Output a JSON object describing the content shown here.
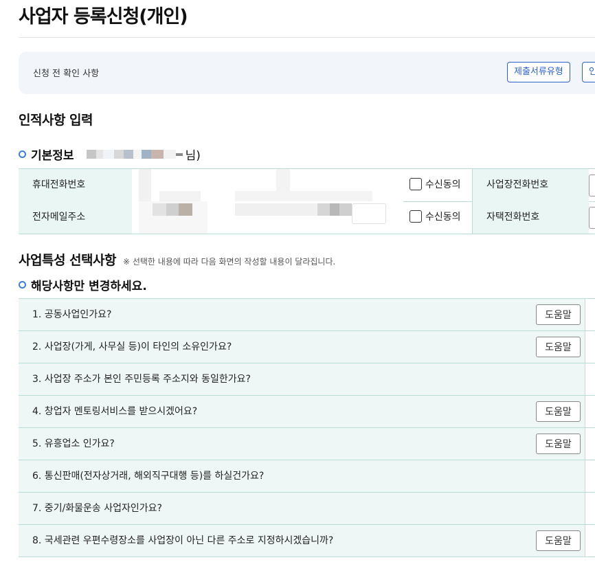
{
  "page": {
    "title": "사업자 등록신청(개인)"
  },
  "notice": {
    "label": "신청 전 확인 사항",
    "buttons": [
      "제출서류유형",
      "인"
    ]
  },
  "personal_info": {
    "section_title": "인적사항 입력",
    "basic_info_title": "기본정보",
    "name_suffix": "님)",
    "rows": [
      {
        "label": "휴대전화번호",
        "consent_label": "수신동의",
        "right_label": "사업장전화번호"
      },
      {
        "label": "전자메일주소",
        "consent_label": "수신동의",
        "right_label": "자택전화번호"
      }
    ]
  },
  "business": {
    "section_title": "사업특성 선택사항",
    "note": "※ 선택한 내용에 따라 다음 화면의 작성할 내용이 달라집니다.",
    "sub_title": "해당사항만 변경하세요.",
    "help_label": "도움말",
    "questions": [
      {
        "text": "1. 공동사업인가요?",
        "has_help": true
      },
      {
        "text": "2. 사업장(가게, 사무실 등)이 타인의 소유인가요?",
        "has_help": true
      },
      {
        "text": "3. 사업장 주소가 본인 주민등록 주소지와 동일한가요?",
        "has_help": false
      },
      {
        "text": "4. 창업자 멘토링서비스를 받으시겠어요?",
        "has_help": true
      },
      {
        "text": "5. 유흥업소 인가요?",
        "has_help": true
      },
      {
        "text": "6. 통신판매(전자상거래, 해외직구대행 등)를 하실건가요?",
        "has_help": false
      },
      {
        "text": "7. 중기/화물운송 사업자인가요?",
        "has_help": false
      },
      {
        "text": "8. 국세관련 우편수령장소를 사업장이 아닌 다른 주소로 지정하시겠습니까?",
        "has_help": true
      }
    ]
  },
  "icons": {
    "section_bullet": "ring-icon"
  },
  "colors": {
    "accent": "#2b62c7",
    "table_header_bg": "#eaf6f4",
    "table_border": "#b9dcd6",
    "bullet": "#3c7de0"
  }
}
